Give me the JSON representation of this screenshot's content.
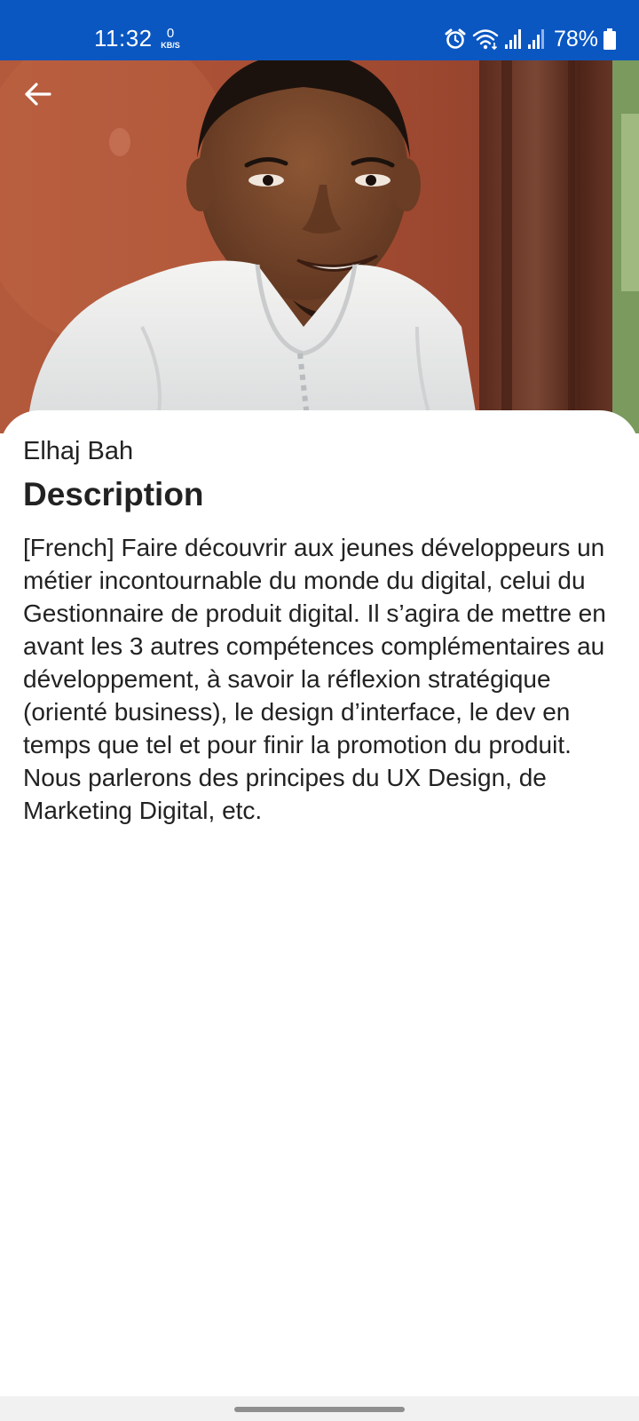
{
  "status_bar": {
    "time": "11:32",
    "net_speed_value": "0",
    "net_speed_unit": "KB/S",
    "battery_percent": "78%",
    "background_color": "#0a57c2",
    "icons": [
      "alarm-icon",
      "wifi-icon",
      "signal-icon",
      "signal-icon",
      "battery-icon"
    ]
  },
  "toolbar": {
    "back_icon": "arrow-left-icon"
  },
  "speaker": {
    "name": "Elhaj Bah"
  },
  "section": {
    "title": "Description"
  },
  "description": {
    "text": "[French] Faire découvrir aux jeunes développeurs un métier incontournable du monde du digital, celui du Gestionnaire de produit digital. Il s’agira de mettre en avant les 3 autres compétences complémentaires au développement, à savoir la réflexion stratégique (orienté business), le design d’interface, le dev en temps que tel et pour finir la promotion du produit. Nous parlerons des principes du UX Design, de Marketing Digital, etc."
  }
}
